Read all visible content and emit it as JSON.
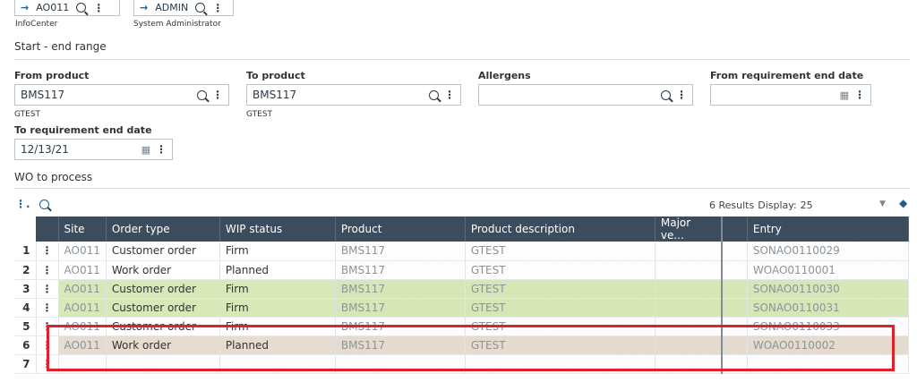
{
  "header": {
    "site_field": {
      "value": "AO011",
      "sub": "InfoCenter"
    },
    "user_field": {
      "value": "ADMIN",
      "sub": "System Administrator"
    }
  },
  "range": {
    "title": "Start - end range",
    "from_product": {
      "label": "From product",
      "value": "BMS117",
      "sub": "GTEST"
    },
    "to_product": {
      "label": "To product",
      "value": "BMS117",
      "sub": "GTEST"
    },
    "allergens": {
      "label": "Allergens",
      "value": ""
    },
    "from_req_end": {
      "label": "From requirement end date",
      "value": ""
    },
    "to_req_end": {
      "label": "To requirement end date",
      "value": "12/13/21"
    }
  },
  "wo": {
    "title": "WO to process",
    "results": "6 Results",
    "display_label": "Display:",
    "display_value": "25",
    "columns": [
      "Site",
      "Order type",
      "WIP status",
      "Product",
      "Product description",
      "Major ve...",
      "Entry"
    ],
    "rows": [
      {
        "n": "1",
        "site": "AO011",
        "type": "Customer order",
        "wip": "Firm",
        "product": "BMS117",
        "desc": "GTEST",
        "major": "",
        "entry": "SONAO0110029"
      },
      {
        "n": "2",
        "site": "AO011",
        "type": "Work order",
        "wip": "Planned",
        "product": "BMS117",
        "desc": "GTEST",
        "major": "",
        "entry": "WOAO0110001"
      },
      {
        "n": "3",
        "site": "AO011",
        "type": "Customer order",
        "wip": "Firm",
        "product": "BMS117",
        "desc": "GTEST",
        "major": "",
        "entry": "SONAO0110030"
      },
      {
        "n": "4",
        "site": "AO011",
        "type": "Customer order",
        "wip": "Firm",
        "product": "BMS117",
        "desc": "GTEST",
        "major": "",
        "entry": "SONAO0110031"
      },
      {
        "n": "5",
        "site": "AO011",
        "type": "Customer order",
        "wip": "Firm",
        "product": "BMS117",
        "desc": "GTEST",
        "major": "",
        "entry": "SONAO0110033"
      },
      {
        "n": "6",
        "site": "AO011",
        "type": "Work order",
        "wip": "Planned",
        "product": "BMS117",
        "desc": "GTEST",
        "major": "",
        "entry": "WOAO0110002"
      },
      {
        "n": "7",
        "site": "",
        "type": "",
        "wip": "",
        "product": "",
        "desc": "",
        "major": "",
        "entry": ""
      }
    ]
  },
  "colors": {
    "header_bg": "#3b4d5c",
    "entry_header_bg": "#0f4a70",
    "green_row": "#d8e8b8",
    "tan_row": "#e6ddd0",
    "highlight": "#e0202a"
  }
}
